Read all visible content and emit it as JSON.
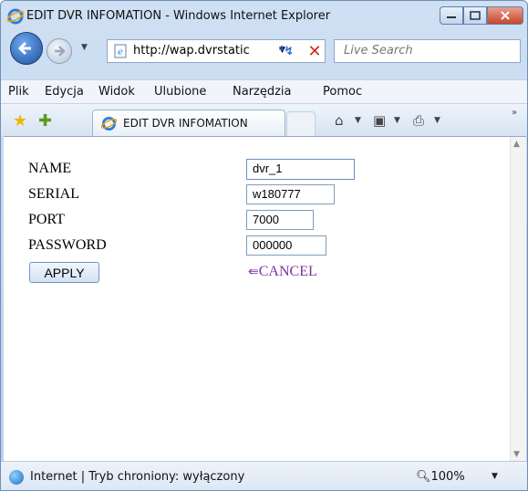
{
  "window": {
    "title": "EDIT DVR INFOMATION - Windows Internet Explorer"
  },
  "nav": {
    "address": "http://wap.dvrstatic",
    "search_placeholder": "Live Search"
  },
  "menu": {
    "items": [
      "Plik",
      "Edycja",
      "Widok",
      "Ulubione",
      "Narzędzia",
      "Pomoc"
    ]
  },
  "tab": {
    "label": "EDIT DVR INFOMATION"
  },
  "form": {
    "name_label": "NAME",
    "name_value": "dvr_1",
    "serial_label": "SERIAL",
    "serial_value": "w180777",
    "port_label": "PORT",
    "port_value": "7000",
    "password_label": "PASSWORD",
    "password_value": "000000",
    "apply_label": "APPLY",
    "cancel_label": "CANCEL"
  },
  "status": {
    "text": "Internet | Tryb chroniony: wyłączony",
    "zoom": "100%"
  },
  "icons": [
    "ie-logo-icon",
    "back-arrow-icon",
    "forward-arrow-icon",
    "refresh-icon",
    "stop-icon",
    "star-favorites-icon",
    "add-favorite-icon",
    "home-icon",
    "feeds-icon",
    "print-icon",
    "globe-icon",
    "zoom-icon",
    "back-link-icon"
  ]
}
